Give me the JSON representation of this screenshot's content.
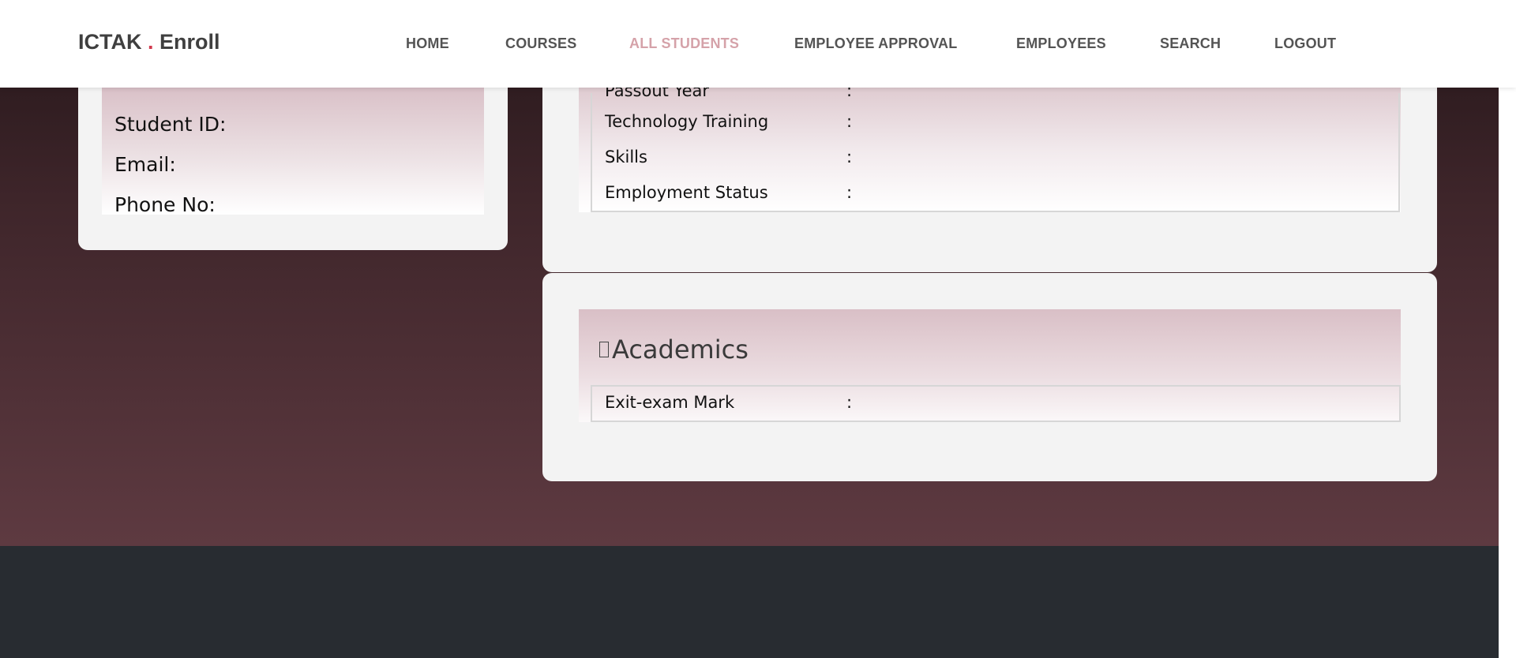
{
  "brand": {
    "name_left": "ICTAK",
    "dot": ".",
    "name_right": "Enroll"
  },
  "nav": {
    "items": [
      {
        "label": "HOME"
      },
      {
        "label": "COURSES"
      },
      {
        "label": "ALL STUDENTS",
        "active": true
      },
      {
        "label": "EMPLOYEE APPROVAL"
      },
      {
        "label": "EMPLOYEES"
      },
      {
        "label": "SEARCH"
      },
      {
        "label": "LOGOUT"
      }
    ]
  },
  "profile": {
    "student_id_label": "Student ID:",
    "email_label": "Email:",
    "phone_label": "Phone No:"
  },
  "info": {
    "rows": [
      {
        "label": "Passout Year",
        "sep": ":"
      },
      {
        "label": "Technology Training",
        "sep": ":"
      },
      {
        "label": "Skills",
        "sep": ":"
      },
      {
        "label": "Employment Status",
        "sep": ":"
      }
    ]
  },
  "academics": {
    "icon": "book-icon",
    "title": "Academics",
    "rows": [
      {
        "label": "Exit-exam Mark",
        "sep": ":"
      }
    ]
  },
  "colors": {
    "accent_active_nav": "#d5a2a9",
    "brand_dot": "#d23a4e",
    "footer": "#282c31"
  }
}
